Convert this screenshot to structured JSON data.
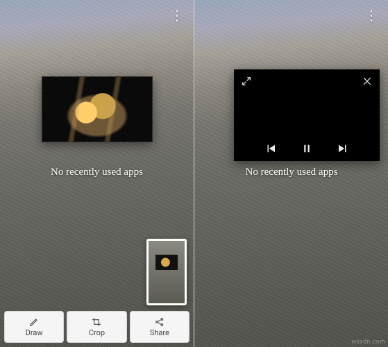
{
  "left": {
    "overflow": "⋮",
    "no_recent": "No recently used apps",
    "toolbar": {
      "draw": "Draw",
      "crop": "Crop",
      "share": "Share"
    }
  },
  "right": {
    "overflow": "⋮",
    "no_recent": "No recently used apps",
    "player": {
      "expand_name": "expand-icon",
      "close_name": "close-icon",
      "prev_name": "previous-track-icon",
      "pause_name": "pause-icon",
      "next_name": "next-track-icon"
    }
  },
  "watermark": "wsxdn.com"
}
